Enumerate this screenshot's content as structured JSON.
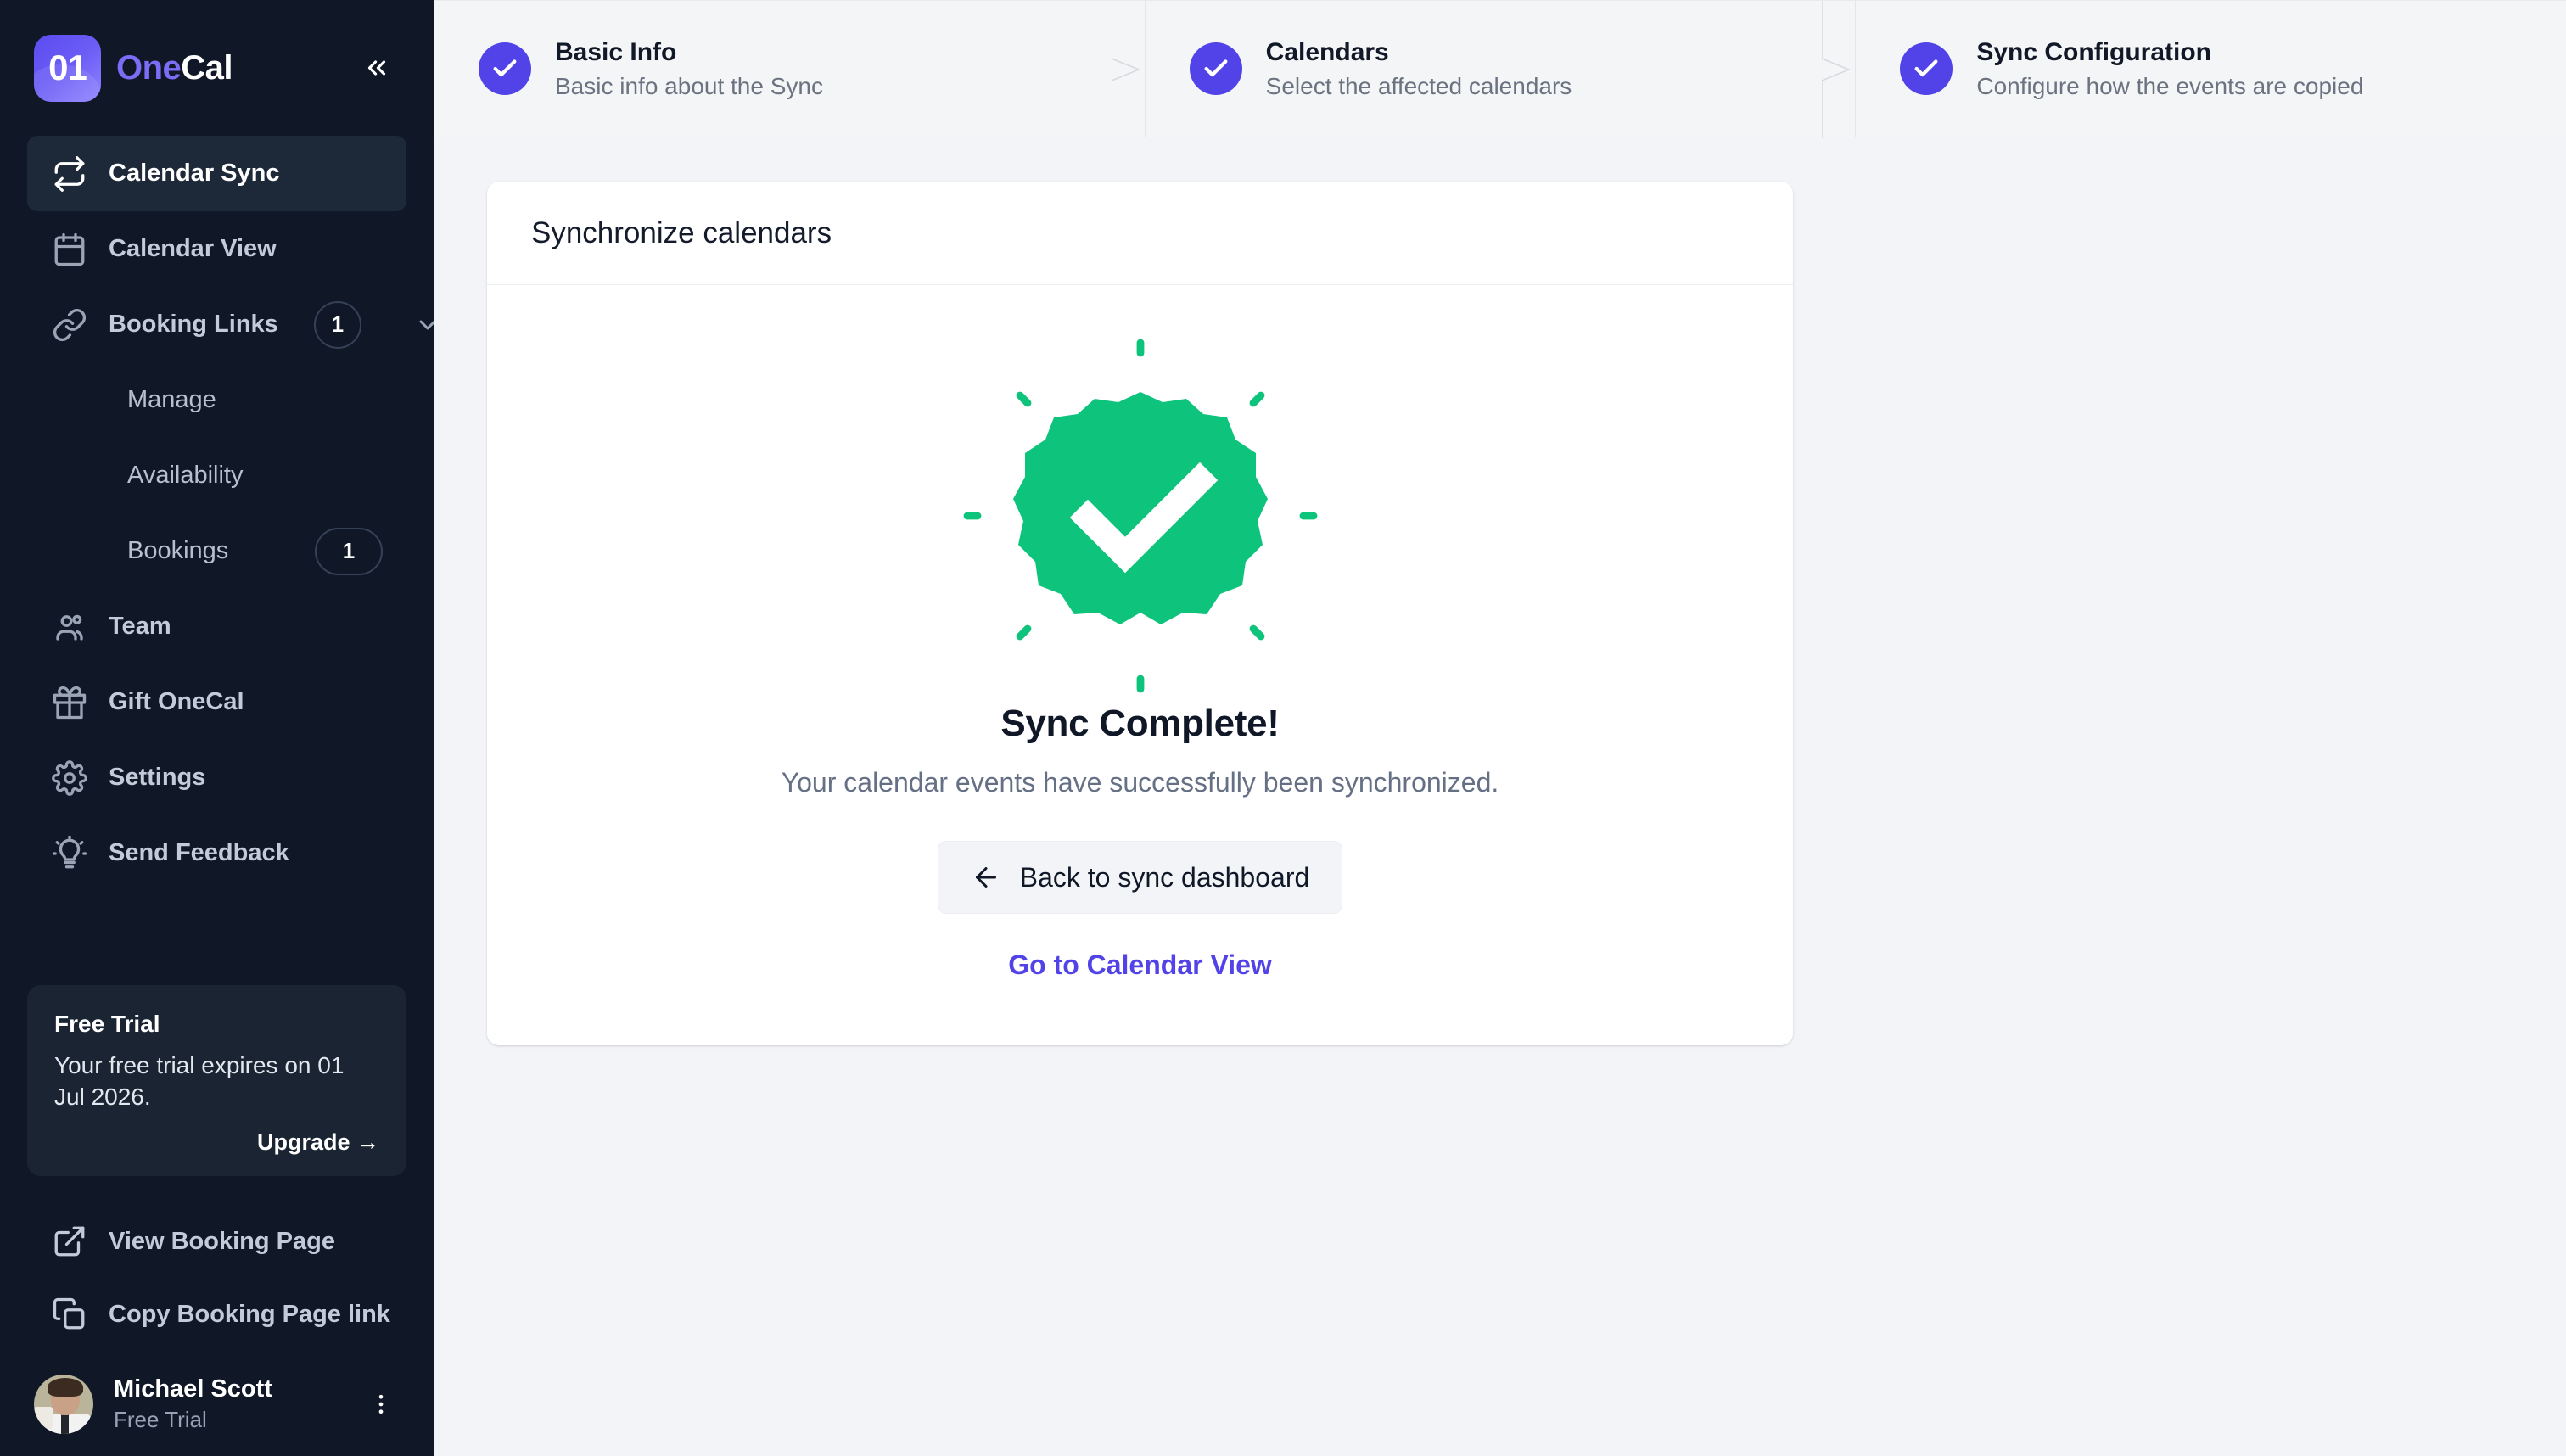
{
  "brand": {
    "logo_text": "01",
    "name_part1": "One",
    "name_part2": "Cal",
    "collapse_icon": "chevrons-left-icon"
  },
  "sidebar": {
    "nav": [
      {
        "id": "calendar-sync",
        "label": "Calendar Sync",
        "icon": "refresh-sync-icon",
        "active": true,
        "badge": ""
      },
      {
        "id": "calendar-view",
        "label": "Calendar View",
        "icon": "calendar-icon",
        "active": false,
        "badge": ""
      },
      {
        "id": "booking-links",
        "label": "Booking Links",
        "icon": "link-icon",
        "active": false,
        "badge": "1",
        "expandable": true
      },
      {
        "id": "manage",
        "label": "Manage",
        "icon": "",
        "active": false,
        "badge": "",
        "sub": true
      },
      {
        "id": "availability",
        "label": "Availability",
        "icon": "",
        "active": false,
        "badge": "",
        "sub": true
      },
      {
        "id": "bookings",
        "label": "Bookings",
        "icon": "",
        "active": false,
        "badge": "1",
        "sub": true
      },
      {
        "id": "team",
        "label": "Team",
        "icon": "users-icon",
        "active": false,
        "badge": ""
      },
      {
        "id": "gift-onecal",
        "label": "Gift OneCal",
        "icon": "gift-icon",
        "active": false,
        "badge": ""
      },
      {
        "id": "settings",
        "label": "Settings",
        "icon": "gear-icon",
        "active": false,
        "badge": ""
      },
      {
        "id": "send-feedback",
        "label": "Send Feedback",
        "icon": "lightbulb-icon",
        "active": false,
        "badge": ""
      }
    ],
    "trial": {
      "title": "Free Trial",
      "text": "Your free trial expires on 01 Jul 2026.",
      "upgrade_label": "Upgrade →"
    },
    "links": [
      {
        "id": "view-booking-page",
        "label": "View Booking Page",
        "icon": "external-link-icon"
      },
      {
        "id": "copy-booking-page-link",
        "label": "Copy Booking Page link",
        "icon": "copy-icon"
      }
    ],
    "user": {
      "name": "Michael Scott",
      "plan": "Free Trial",
      "menu_icon": "dots-vertical-icon"
    }
  },
  "stepper": {
    "steps": [
      {
        "id": "basic-info",
        "title": "Basic Info",
        "subtitle": "Basic info about the Sync",
        "state": "complete",
        "icon": "check-icon"
      },
      {
        "id": "calendars",
        "title": "Calendars",
        "subtitle": "Select the affected calendars",
        "state": "complete",
        "icon": "check-icon"
      },
      {
        "id": "sync-configuration",
        "title": "Sync Configuration",
        "subtitle": "Configure how the events are copied",
        "state": "complete",
        "icon": "check-icon"
      }
    ]
  },
  "card": {
    "title": "Synchronize calendars",
    "success_icon": "success-badge-check-icon",
    "heading": "Sync Complete!",
    "message": "Your calendar events have successfully been synchronized.",
    "back_button": {
      "label": "Back to sync dashboard",
      "icon": "arrow-left-icon"
    },
    "secondary_link": {
      "label": "Go to Calendar View"
    }
  },
  "colors": {
    "sidebar_bg": "#101828",
    "sidebar_active": "#1d2839",
    "brand_purple": "#5243e9",
    "accent_purple": "#7c6df7",
    "success_green": "#0ec37c",
    "page_bg": "#f2f4f7",
    "card_bg": "#ffffff"
  }
}
